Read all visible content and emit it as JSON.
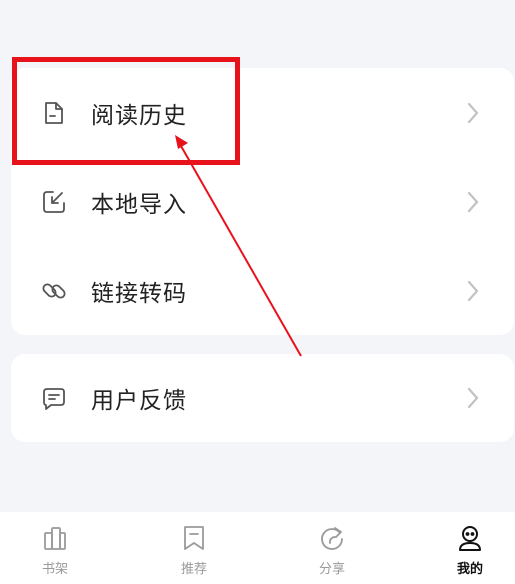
{
  "menu_group_1": {
    "items": [
      {
        "label": "阅读历史",
        "icon": "reading-history-icon"
      },
      {
        "label": "本地导入",
        "icon": "local-import-icon"
      },
      {
        "label": "链接转码",
        "icon": "link-icon"
      }
    ]
  },
  "menu_group_2": {
    "items": [
      {
        "label": "用户反馈",
        "icon": "feedback-icon"
      }
    ]
  },
  "bottom_nav": {
    "items": [
      {
        "label": "书架",
        "icon": "bookshelf-icon",
        "active": false
      },
      {
        "label": "推荐",
        "icon": "bookmark-icon",
        "active": false
      },
      {
        "label": "分享",
        "icon": "share-icon",
        "active": false
      },
      {
        "label": "我的",
        "icon": "profile-icon",
        "active": true
      }
    ]
  },
  "colors": {
    "background": "#f4f5f9",
    "card": "#ffffff",
    "annotation": "#e8121b",
    "nav_inactive": "#9a9a9a",
    "nav_active": "#111111"
  }
}
